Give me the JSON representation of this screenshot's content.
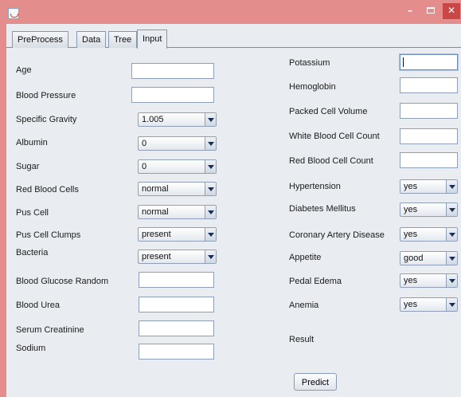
{
  "tabs": [
    "PreProcess",
    "Data",
    "Tree",
    "Input"
  ],
  "window_buttons": {
    "minimize": "–",
    "close": "✕"
  },
  "left": {
    "age": "Age",
    "blood_pressure": "Blood Pressure",
    "specific_gravity": {
      "label": "Specific Gravity",
      "value": "1.005"
    },
    "albumin": {
      "label": "Albumin",
      "value": "0"
    },
    "sugar": {
      "label": "Sugar",
      "value": "0"
    },
    "red_blood_cells": {
      "label": "Red Blood Cells",
      "value": "normal"
    },
    "pus_cell": {
      "label": "Pus Cell",
      "value": "normal"
    },
    "pus_cell_clumps": {
      "label": "Pus Cell Clumps",
      "value": "present"
    },
    "bacteria": {
      "label": "Bacteria",
      "value": "present"
    },
    "blood_glucose_random": "Blood Glucose Random",
    "blood_urea": "Blood Urea",
    "serum_creatinine": "Serum Creatinine",
    "sodium": "Sodium"
  },
  "right": {
    "potassium": "Potassium",
    "hemoglobin": "Hemoglobin",
    "packed_cell_volume": "Packed Cell Volume",
    "white_blood_cell_count": "White Blood Cell Count",
    "red_blood_cell_count": "Red Blood Cell Count",
    "hypertension": {
      "label": "Hypertension",
      "value": "yes"
    },
    "diabetes_mellitus": {
      "label": "Diabetes Mellitus",
      "value": "yes"
    },
    "coronary_artery_disease": {
      "label": "Coronary Artery Disease",
      "value": "yes"
    },
    "appetite": {
      "label": "Appetite",
      "value": "good"
    },
    "pedal_edema": {
      "label": "Pedal Edema",
      "value": "yes"
    },
    "anemia": {
      "label": "Anemia",
      "value": "yes"
    }
  },
  "result_label": "Result",
  "predict_label": "Predict"
}
